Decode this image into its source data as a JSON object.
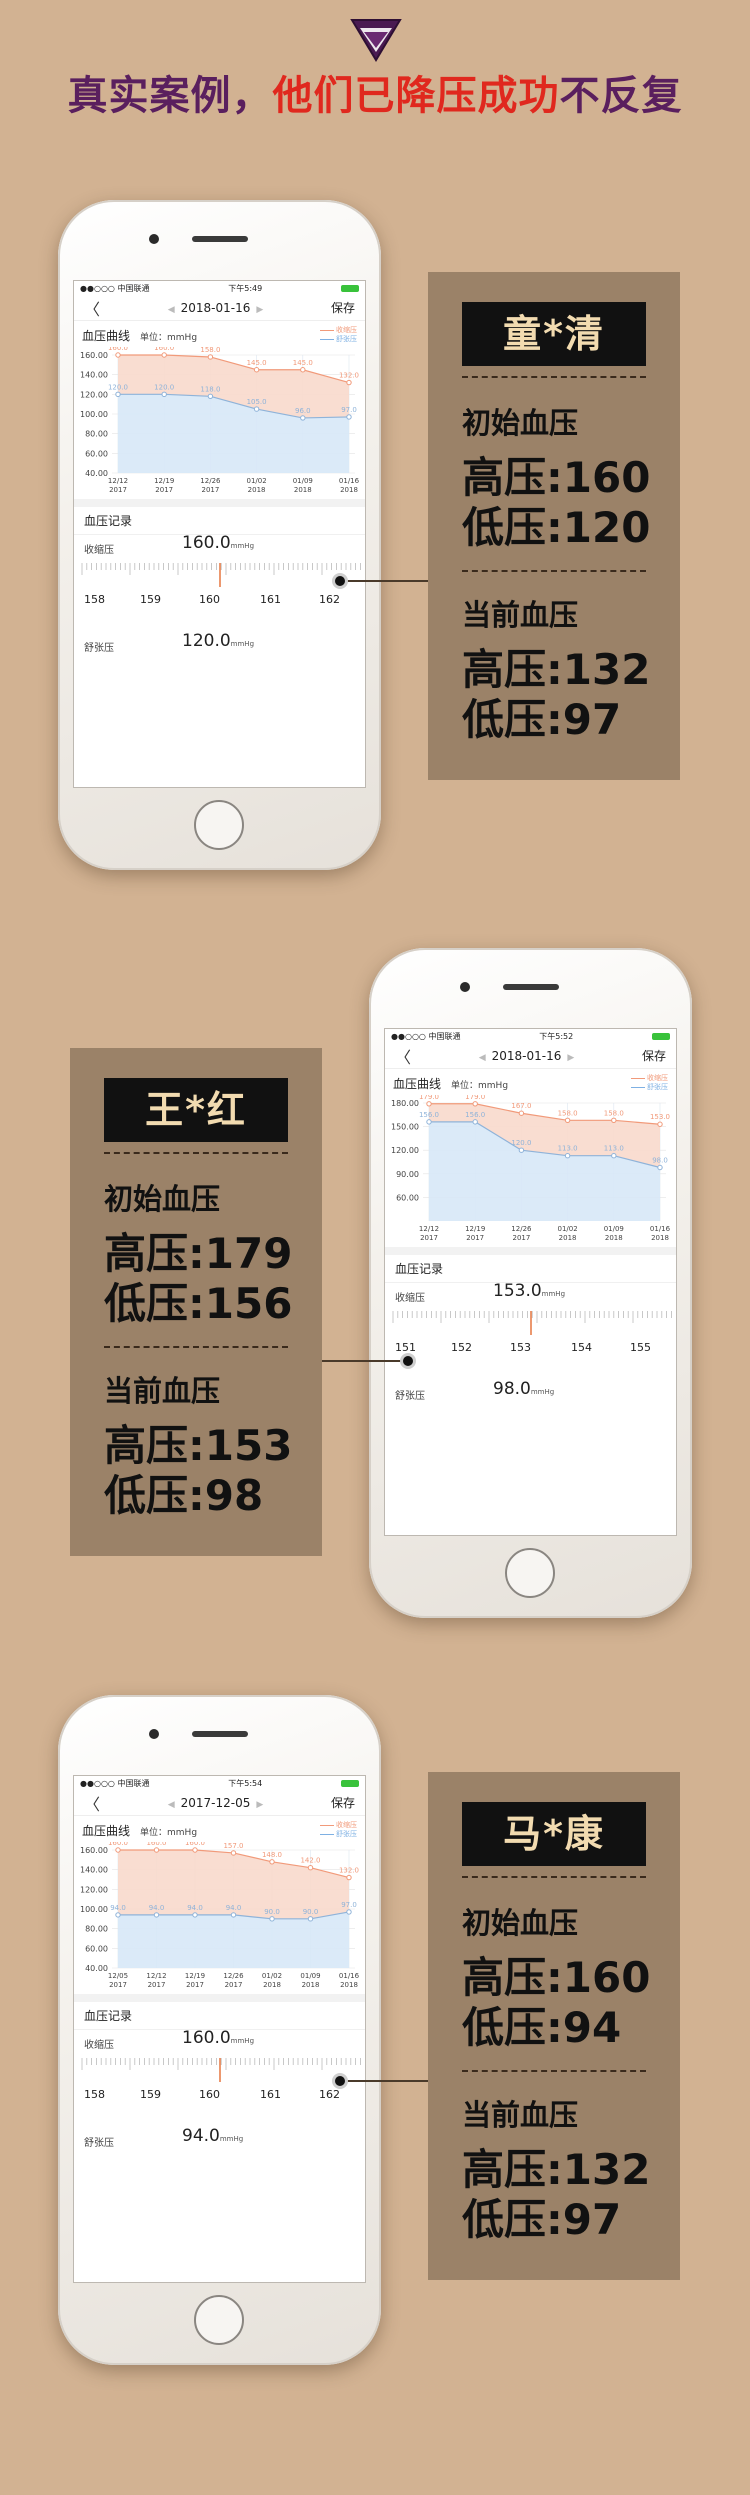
{
  "header": {
    "title_part1": "真实案例，",
    "title_part2": "他们已降压成功",
    "title_part3": "不反复"
  },
  "common": {
    "carrier": "●●○○○ 中国联通",
    "back": "〈",
    "save": "保存",
    "chart_title": "血压曲线",
    "unit": "单位：mmHg",
    "legend_sys": "收缩压",
    "legend_dia": "舒张压",
    "record_title": "血压记录",
    "sys_label": "收缩压",
    "dia_label": "舒张压",
    "value_unit": "mmHg"
  },
  "cases": [
    {
      "time": "下午5:49",
      "date": "2018-01-16",
      "name": "童*清",
      "initial_label": "初始血压",
      "initial_high": "高压:160",
      "initial_low": "低压:120",
      "current_label": "当前血压",
      "current_high": "高压:132",
      "current_low": "低压:97",
      "sys_value": "160.0",
      "dia_value": "120.0",
      "ruler": [
        "158",
        "159",
        "160",
        "161",
        "162"
      ],
      "chart_data": {
        "type": "line",
        "x": [
          "12/12 2017",
          "12/19 2017",
          "12/26 2017",
          "01/02 2018",
          "01/09 2018",
          "01/16 2018"
        ],
        "y_ticks": [
          "160.00",
          "140.00",
          "120.00",
          "100.00",
          "80.00",
          "60.00",
          "40.00"
        ],
        "ylim": [
          40,
          160
        ],
        "series": [
          {
            "name": "收缩压",
            "values": [
              160,
              160,
              158,
              145,
              145,
              132
            ],
            "labels": [
              "160.0",
              "160.0",
              "158.0",
              "145.0",
              "145.0",
              "132.0"
            ]
          },
          {
            "name": "舒张压",
            "values": [
              120,
              120,
              118,
              105,
              96,
              97
            ],
            "labels": [
              "120.0",
              "120.0",
              "118.0",
              "105.0",
              "96.0",
              "97.0"
            ]
          }
        ]
      }
    },
    {
      "time": "下午5:52",
      "date": "2018-01-16",
      "name": "王*红",
      "initial_label": "初始血压",
      "initial_high": "高压:179",
      "initial_low": "低压:156",
      "current_label": "当前血压",
      "current_high": "高压:153",
      "current_low": "低压:98",
      "sys_value": "153.0",
      "dia_value": "98.0",
      "ruler": [
        "151",
        "152",
        "153",
        "154",
        "155"
      ],
      "chart_data": {
        "type": "line",
        "x": [
          "12/12 2017",
          "12/19 2017",
          "12/26 2017",
          "01/02 2018",
          "01/09 2018",
          "01/16 2018"
        ],
        "y_ticks": [
          "180.00",
          "150.00",
          "120.00",
          "90.00",
          "60.00"
        ],
        "ylim": [
          30,
          180
        ],
        "series": [
          {
            "name": "收缩压",
            "values": [
              179,
              179,
              167,
              158,
              158,
              153
            ],
            "labels": [
              "179.0",
              "179.0",
              "167.0",
              "158.0",
              "158.0",
              "153.0"
            ]
          },
          {
            "name": "舒张压",
            "values": [
              156,
              156,
              120,
              113,
              113,
              98
            ],
            "labels": [
              "156.0",
              "156.0",
              "120.0",
              "113.0",
              "113.0",
              "98.0"
            ]
          }
        ]
      }
    },
    {
      "time": "下午5:54",
      "date": "2017-12-05",
      "name": "马*康",
      "initial_label": "初始血压",
      "initial_high": "高压:160",
      "initial_low": "低压:94",
      "current_label": "当前血压",
      "current_high": "高压:132",
      "current_low": "低压:97",
      "sys_value": "160.0",
      "dia_value": "94.0",
      "ruler": [
        "158",
        "159",
        "160",
        "161",
        "162"
      ],
      "chart_data": {
        "type": "line",
        "x": [
          "12/05 2017",
          "12/12 2017",
          "12/19 2017",
          "12/26 2017",
          "01/02 2018",
          "01/09 2018",
          "01/16 2018"
        ],
        "y_ticks": [
          "160.00",
          "140.00",
          "120.00",
          "100.00",
          "80.00",
          "60.00",
          "40.00"
        ],
        "ylim": [
          40,
          160
        ],
        "series": [
          {
            "name": "收缩压",
            "values": [
              160,
              160,
              160,
              157,
              148,
              142,
              132
            ],
            "labels": [
              "160.0",
              "160.0",
              "160.0",
              "157.0",
              "148.0",
              "142.0",
              "132.0"
            ]
          },
          {
            "name": "舒张压",
            "values": [
              94,
              94,
              94,
              94,
              90,
              90,
              97
            ],
            "labels": [
              "94.0",
              "94.0",
              "94.0",
              "94.0",
              "90.0",
              "90.0",
              "97.0"
            ]
          }
        ]
      }
    }
  ]
}
